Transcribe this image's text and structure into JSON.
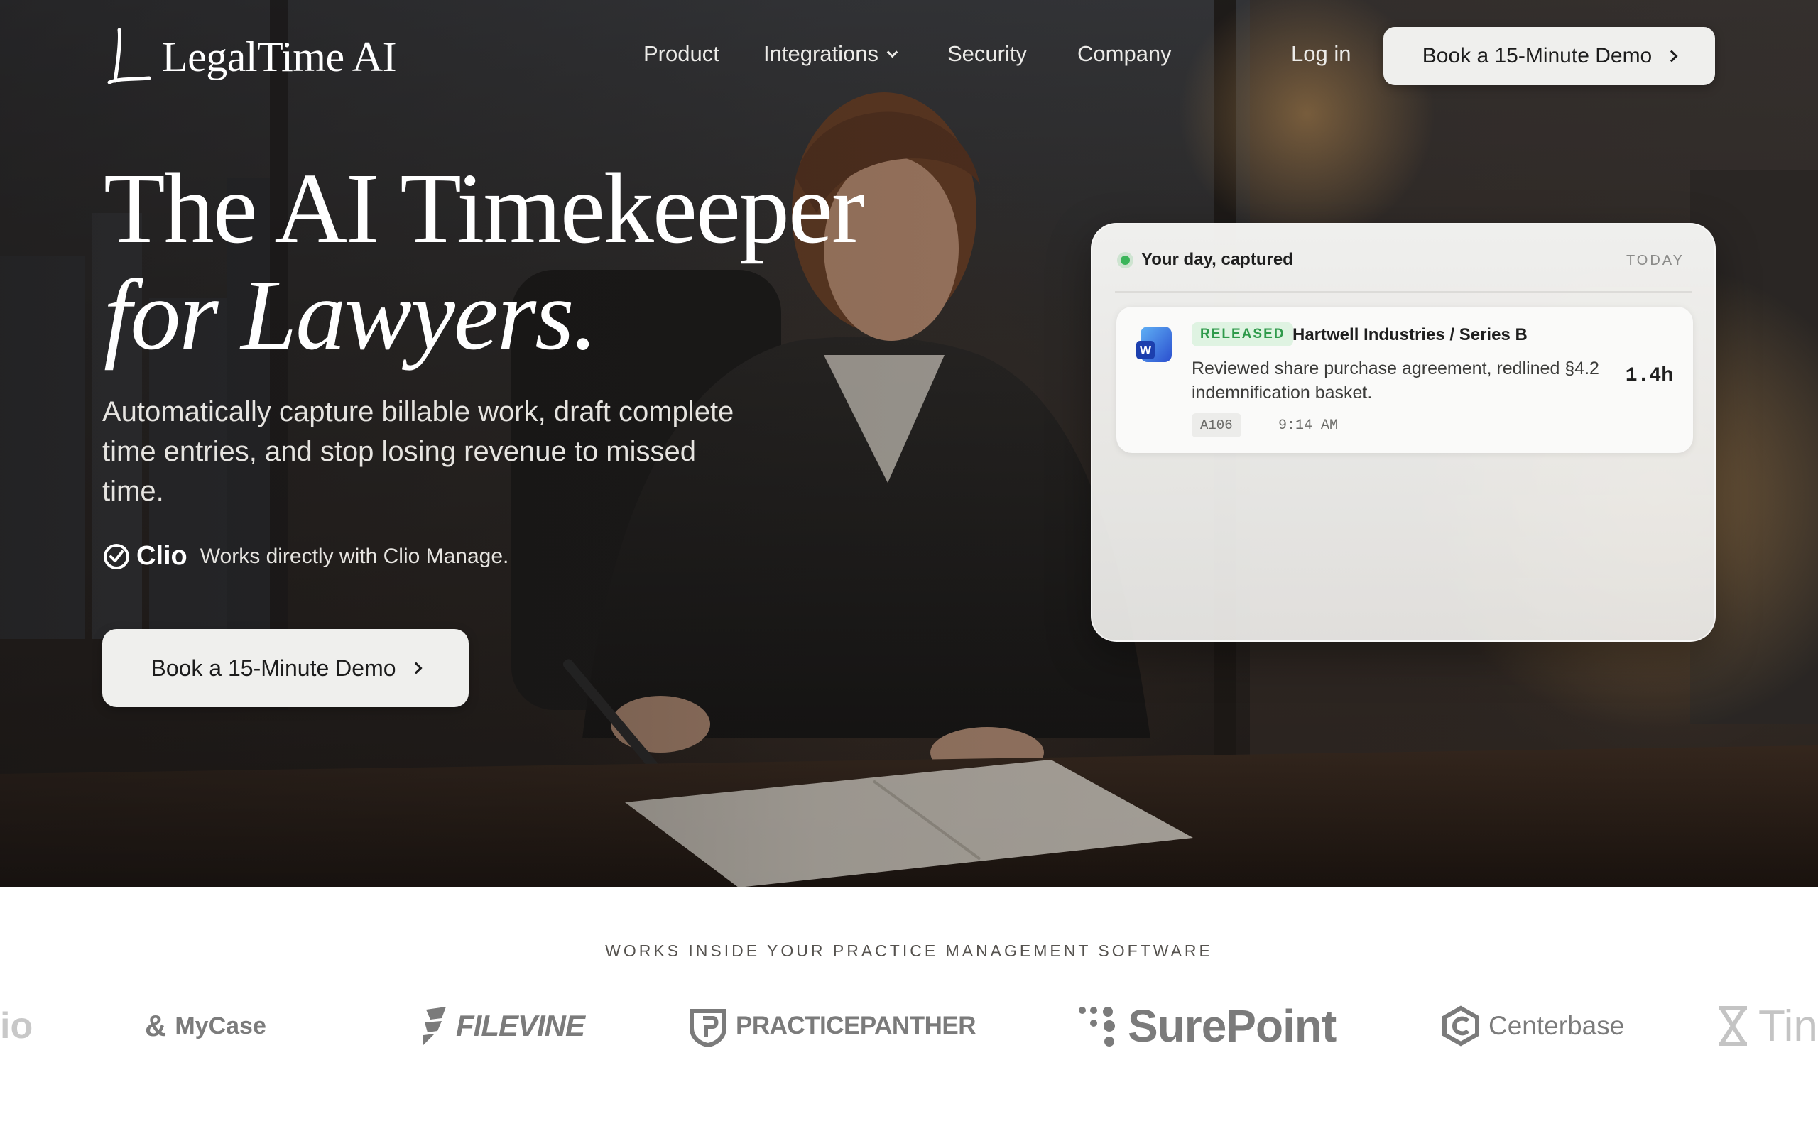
{
  "nav": {
    "brand": "LegalTime AI",
    "links": [
      "Product",
      "Integrations",
      "Security",
      "Company"
    ],
    "login": "Log in",
    "cta": "Book a 15-Minute Demo"
  },
  "hero": {
    "headline_line1": "The AI Timekeeper",
    "headline_line2": "for Lawyers.",
    "subtitle": "Automatically capture billable work, draft complete time entries, and stop losing revenue to missed time.",
    "clio_brand": "Clio",
    "clio_text": "Works directly with Clio Manage.",
    "cta": "Book a 15-Minute Demo"
  },
  "card": {
    "title": "Your day, captured",
    "date_label": "TODAY",
    "entry": {
      "status": "RELEASED",
      "matter": "Hartwell Industries / Series B",
      "description": "Reviewed share purchase agreement, redlined §4.2 indemnification basket.",
      "code": "A106",
      "time": "9:14 AM",
      "hours": "1.4h"
    }
  },
  "integrations": {
    "title": "WORKS INSIDE YOUR PRACTICE MANAGEMENT SOFTWARE",
    "logos": [
      "io",
      "MyCase",
      "FILEVINE",
      "PRACTICEPANTHER",
      "SurePoint",
      "Centerbase",
      "Tin"
    ]
  },
  "colors": {
    "status_green": "#2f9a4b",
    "live_dot": "#3bb55a",
    "logo_gray": "#7b7b7b"
  }
}
